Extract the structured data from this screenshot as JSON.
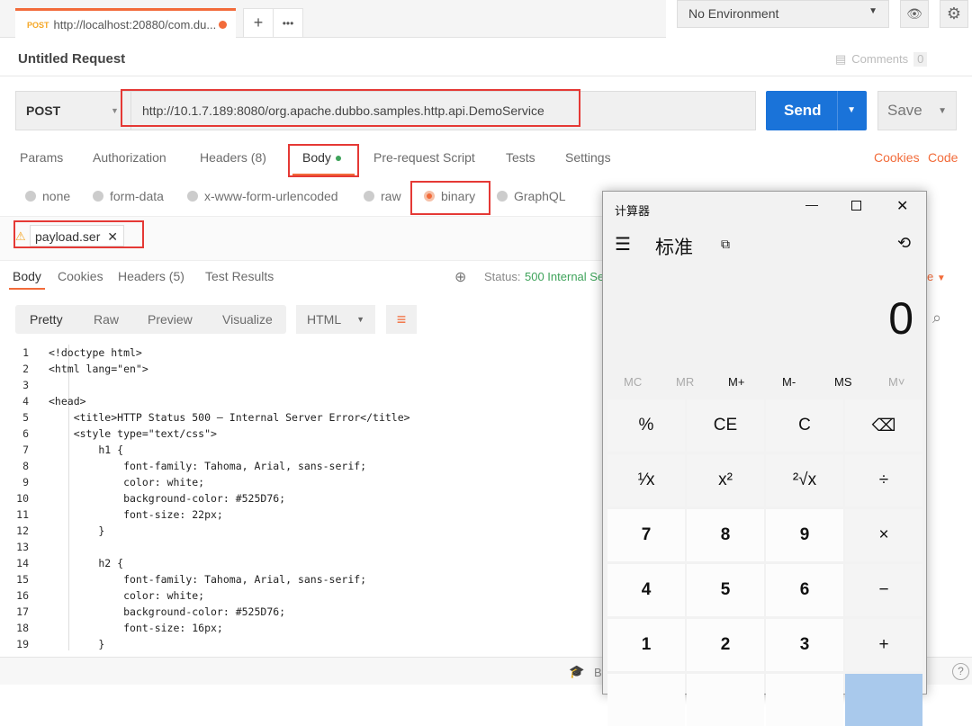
{
  "tabs": {
    "active": {
      "method": "POST",
      "url": "http://localhost:20880/com.du..."
    },
    "new": "+",
    "more": "•••"
  },
  "env": {
    "selected": "No Environment"
  },
  "request": {
    "title": "Untitled Request",
    "comments": "Comments",
    "comments_count": "0",
    "method": "POST",
    "url": "http://10.1.7.189:8080/org.apache.dubbo.samples.http.api.DemoService",
    "send": "Send",
    "save": "Save"
  },
  "req_tabs": [
    "Params",
    "Authorization",
    "Headers (8)",
    "Body",
    "Pre-request Script",
    "Tests",
    "Settings"
  ],
  "req_links": {
    "cookies": "Cookies",
    "code": "Code"
  },
  "body_types": [
    "none",
    "form-data",
    "x-www-form-urlencoded",
    "raw",
    "binary",
    "GraphQL"
  ],
  "file": {
    "name": "payload.ser",
    "remove": "✕"
  },
  "resp_tabs": [
    "Body",
    "Cookies",
    "Headers (5)",
    "Test Results"
  ],
  "status": {
    "label": "Status:",
    "value": "500 Internal Se",
    "save": "e"
  },
  "view": {
    "modes": [
      "Pretty",
      "Raw",
      "Preview",
      "Visualize"
    ],
    "format": "HTML"
  },
  "code_lines": [
    "<!doctype html>",
    "<html lang=\"en\">",
    "",
    "<head>",
    "    <title>HTTP Status 500 – Internal Server Error</title>",
    "    <style type=\"text/css\">",
    "        h1 {",
    "            font-family: Tahoma, Arial, sans-serif;",
    "            color: white;",
    "            background-color: #525D76;",
    "            font-size: 22px;",
    "        }",
    "",
    "        h2 {",
    "            font-family: Tahoma, Arial, sans-serif;",
    "            color: white;",
    "            background-color: #525D76;",
    "            font-size: 16px;",
    "        }"
  ],
  "footer": {
    "bootcamp": "B"
  },
  "calculator": {
    "title": "计算器",
    "mode": "标准",
    "display": "0",
    "memory": [
      "MC",
      "MR",
      "M+",
      "M-",
      "MS",
      "M˅"
    ],
    "keys": [
      [
        "%",
        "CE",
        "C",
        "⌫"
      ],
      [
        "¹⁄x",
        "x²",
        "²√x",
        "÷"
      ],
      [
        "7",
        "8",
        "9",
        "×"
      ],
      [
        "4",
        "5",
        "6",
        "−"
      ],
      [
        "1",
        "2",
        "3",
        "+"
      ]
    ]
  },
  "colors": {
    "accent": "#f26b3a",
    "send": "#1a73d9",
    "status": "#3fa35b",
    "highlight": "#e53935"
  }
}
